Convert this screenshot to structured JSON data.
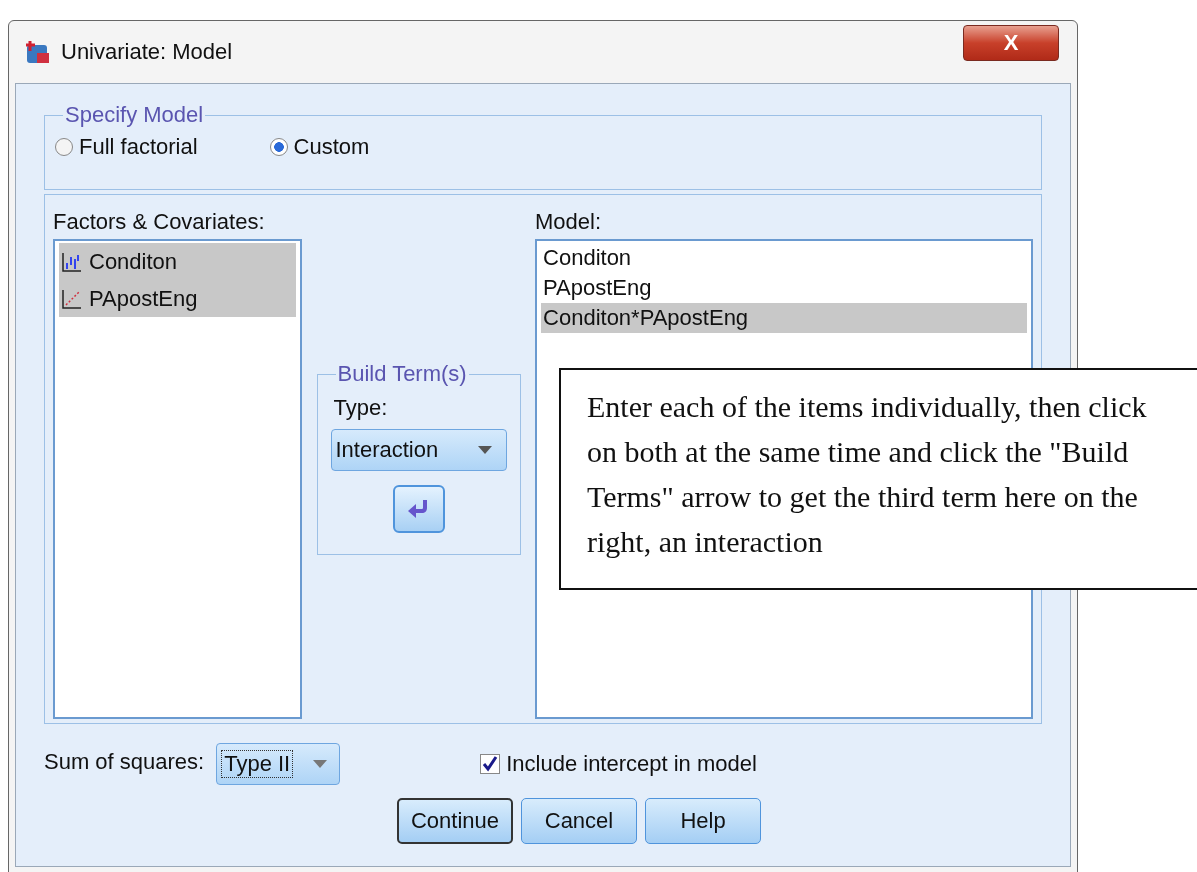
{
  "window": {
    "title": "Univariate: Model",
    "close_label": "X"
  },
  "specify_model": {
    "title": "Specify Model",
    "options": [
      {
        "label": "Full factorial",
        "selected": false
      },
      {
        "label": "Custom",
        "selected": true
      }
    ]
  },
  "factors": {
    "label": "Factors & Covariates:",
    "items": [
      {
        "name": "Conditon",
        "kind": "nominal",
        "selected": true
      },
      {
        "name": "PApostEng",
        "kind": "scale",
        "selected": true
      }
    ]
  },
  "build_terms": {
    "title": "Build Term(s)",
    "type_label": "Type:",
    "type_value": "Interaction"
  },
  "model": {
    "label": "Model:",
    "items": [
      {
        "name": "Conditon",
        "selected": false
      },
      {
        "name": "PApostEng",
        "selected": false
      },
      {
        "name": "Conditon*PApostEng",
        "selected": true
      }
    ]
  },
  "sum_of_squares": {
    "label": "Sum of squares:",
    "value": "Type II"
  },
  "include_intercept": {
    "label": "Include intercept in model",
    "checked": true
  },
  "buttons": [
    {
      "label": "Continue",
      "default": true
    },
    {
      "label": "Cancel",
      "default": false
    },
    {
      "label": "Help",
      "default": false
    }
  ],
  "callout": {
    "text": "Enter each of the items individually, then click on both at the same time and click the \"Build Terms\" arrow to get the third term here on the right, an interaction"
  }
}
